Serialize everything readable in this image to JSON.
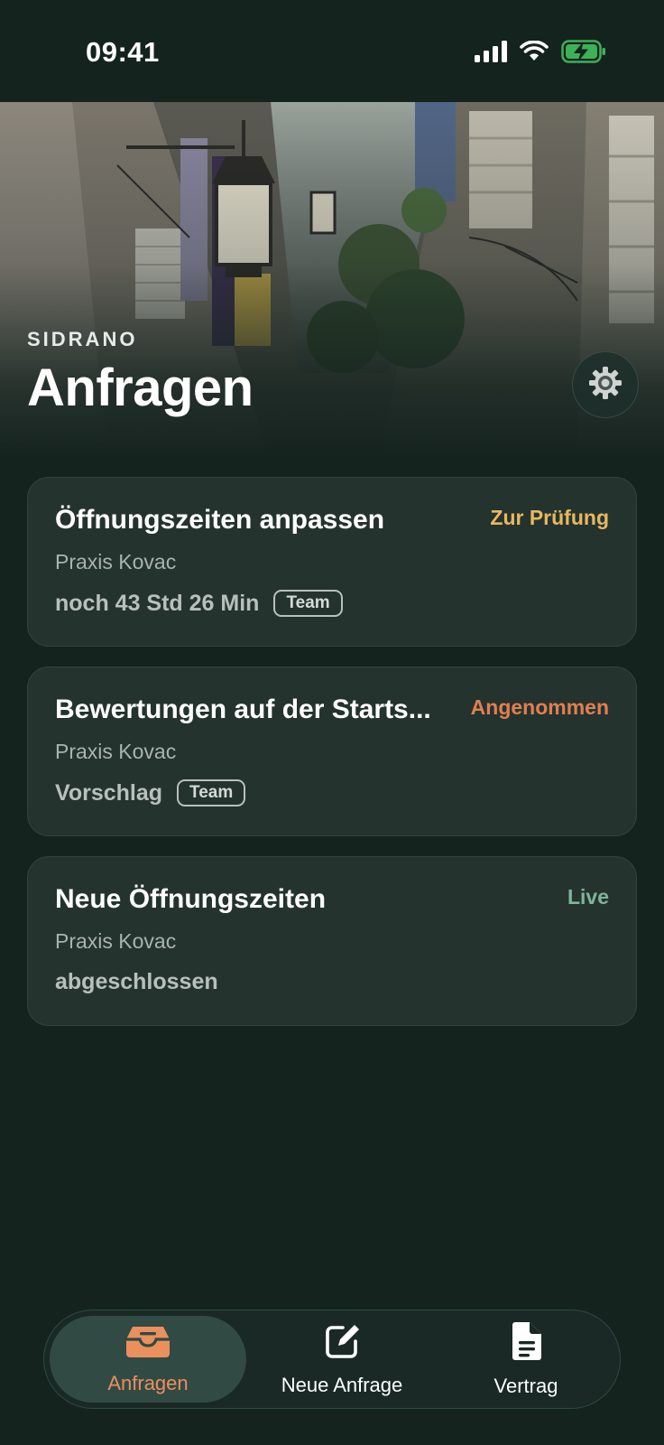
{
  "status_bar": {
    "time": "09:41"
  },
  "header": {
    "brand": "SIDRANO",
    "title": "Anfragen"
  },
  "requests": [
    {
      "title": "Öffnungszeiten anpassen",
      "status": "Zur Prüfung",
      "status_color": "#e8b95f",
      "client": "Praxis Kovac",
      "meta": "noch 43 Std 26 Min",
      "tag": "Team"
    },
    {
      "title": "Bewertungen auf der Starts...",
      "status": "Angenommen",
      "status_color": "#e27f50",
      "client": "Praxis Kovac",
      "meta": "Vorschlag",
      "tag": "Team"
    },
    {
      "title": "Neue Öffnungszeiten",
      "status": "Live",
      "status_color": "#7fb59a",
      "client": "Praxis Kovac",
      "meta": "abgeschlossen",
      "tag": ""
    }
  ],
  "tab_bar": {
    "items": [
      {
        "label": "Anfragen",
        "icon": "inbox-tray-icon",
        "active": true
      },
      {
        "label": "Neue Anfrage",
        "icon": "compose-icon",
        "active": false
      },
      {
        "label": "Vertrag",
        "icon": "document-icon",
        "active": false
      }
    ],
    "active_color": "#e9905e",
    "inactive_color": "#ffffff"
  },
  "colors": {
    "background": "#15231f",
    "card": "#25332f",
    "accent": "#e9905e"
  }
}
